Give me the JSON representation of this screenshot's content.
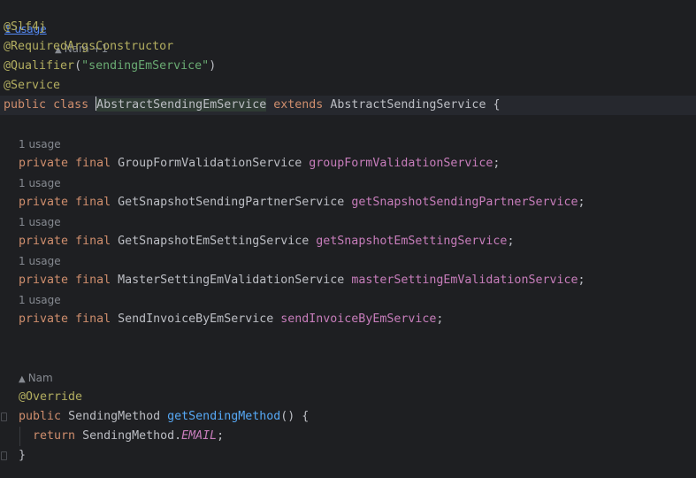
{
  "header": {
    "usage_link": "1 usage",
    "authors": "Nam +1"
  },
  "code": {
    "annotations": {
      "slf4j": "@Slf4j",
      "required_args": "@RequiredArgsConstructor",
      "qualifier_name": "@Qualifier",
      "qualifier_open": "(",
      "qualifier_value": "\"sendingEmService\"",
      "qualifier_close": ")",
      "service": "@Service"
    },
    "class_decl": {
      "kw_public": "public",
      "kw_class": "class",
      "name": "AbstractSendingEmService",
      "kw_extends": "extends",
      "parent": "AbstractSendingService",
      "brace": "{"
    },
    "fields": [
      {
        "usage": "1 usage",
        "mod1": "private",
        "mod2": "final",
        "type": "GroupFormValidationService",
        "name": "groupFormValidationService",
        "semi": ";"
      },
      {
        "usage": "1 usage",
        "mod1": "private",
        "mod2": "final",
        "type": "GetSnapshotSendingPartnerService",
        "name": "getSnapshotSendingPartnerService",
        "semi": ";"
      },
      {
        "usage": "1 usage",
        "mod1": "private",
        "mod2": "final",
        "type": "GetSnapshotEmSettingService",
        "name": "getSnapshotEmSettingService",
        "semi": ";"
      },
      {
        "usage": "1 usage",
        "mod1": "private",
        "mod2": "final",
        "type": "MasterSettingEmValidationService",
        "name": "masterSettingEmValidationService",
        "semi": ";"
      },
      {
        "usage": "1 usage",
        "mod1": "private",
        "mod2": "final",
        "type": "SendInvoiceByEmService",
        "name": "sendInvoiceByEmService",
        "semi": ";"
      }
    ],
    "method": {
      "author": "Nam",
      "override": "@Override",
      "kw_public": "public",
      "return_type": "SendingMethod",
      "name": "getSendingMethod",
      "params": "() {",
      "kw_return": "return",
      "ret_class": "SendingMethod.",
      "ret_const": "EMAIL",
      "ret_semi": ";",
      "close_brace": "}"
    }
  },
  "colors": {
    "background": "#1e1f22",
    "keyword": "#cf8e6d",
    "annotation": "#b3ae60",
    "string": "#6aab73",
    "field": "#c77dbb",
    "method": "#56a8f5",
    "hint": "#868a91",
    "link": "#548af7"
  }
}
